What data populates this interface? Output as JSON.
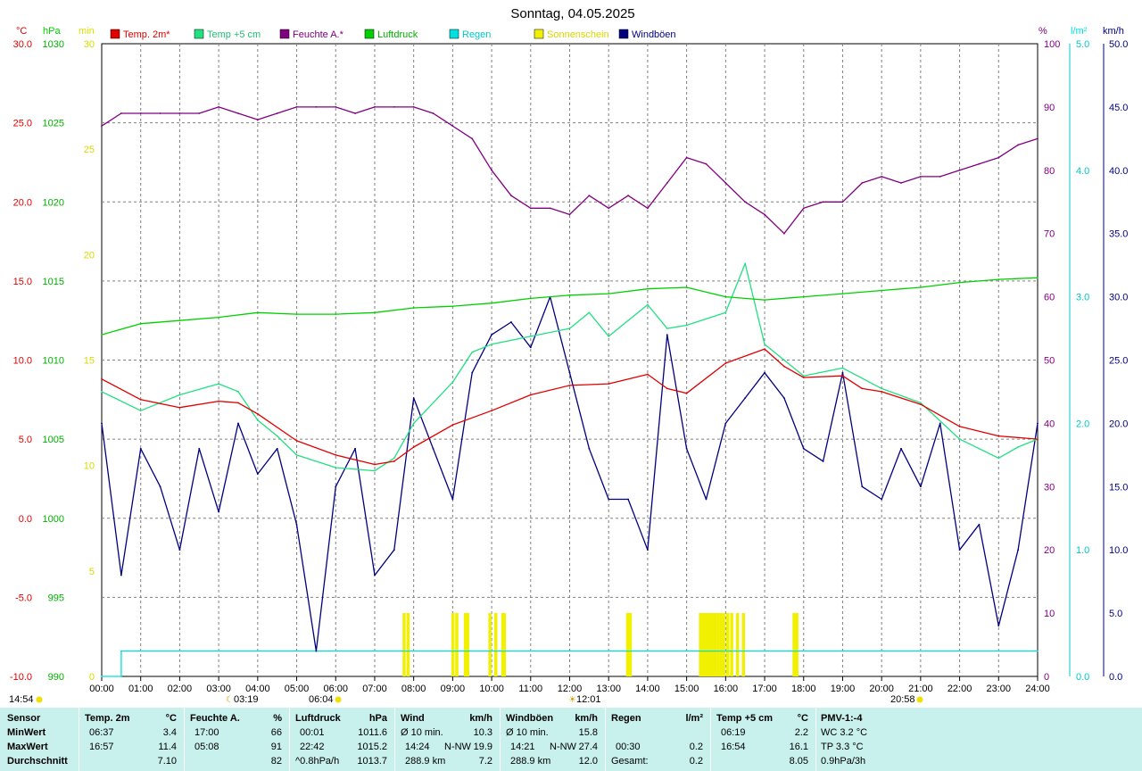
{
  "title": "Sonntag, 04.05.2025",
  "colors": {
    "temp2m": "#e00000",
    "temp5cm": "#20e080",
    "humidity": "#800080",
    "pressure": "#00d000",
    "rain": "#00e0e0",
    "sunshine": "#f0f000",
    "gust": "#00007f",
    "grid": "#808080",
    "stats_bg": "#c8f0ec"
  },
  "chart_data": {
    "type": "line",
    "x_ticks": [
      "00:00",
      "01:00",
      "02:00",
      "03:00",
      "04:00",
      "05:00",
      "06:00",
      "07:00",
      "08:00",
      "09:00",
      "10:00",
      "11:00",
      "12:00",
      "13:00",
      "14:00",
      "15:00",
      "16:00",
      "17:00",
      "18:00",
      "19:00",
      "20:00",
      "21:00",
      "22:00",
      "23:00",
      "24:00"
    ],
    "axes": {
      "temp": {
        "unit": "°C",
        "ticks": [
          "30.0",
          "25.0",
          "20.0",
          "15.0",
          "10.0",
          "5.0",
          "0.0",
          "-5.0",
          "-10.0"
        ],
        "range": [
          -10,
          30
        ]
      },
      "pressure": {
        "unit": "hPa",
        "ticks": [
          "1030",
          "1025",
          "1020",
          "1015",
          "1010",
          "1005",
          "1000",
          "995",
          "990"
        ],
        "range": [
          990,
          1030
        ]
      },
      "sun_min": {
        "unit": "min",
        "ticks": [
          "30",
          "25",
          "20",
          "15",
          "10",
          "5",
          "0"
        ],
        "range": [
          0,
          30
        ]
      },
      "humidity": {
        "unit": "%",
        "ticks": [
          "100",
          "90",
          "80",
          "70",
          "60",
          "50",
          "40",
          "30",
          "20",
          "10",
          "0"
        ],
        "range": [
          0,
          100
        ]
      },
      "rain": {
        "unit": "l/m²",
        "ticks": [
          "5.0",
          "4.0",
          "3.0",
          "2.0",
          "1.0",
          "0.0"
        ],
        "range": [
          0,
          5
        ]
      },
      "wind": {
        "unit": "km/h",
        "ticks": [
          "50.0",
          "45.0",
          "40.0",
          "35.0",
          "30.0",
          "25.0",
          "20.0",
          "15.0",
          "10.0",
          "5.0",
          "0.0"
        ],
        "range": [
          0,
          50
        ]
      }
    },
    "legend": [
      "Temp. 2m*",
      "Temp +5 cm",
      "Feuchte A.*",
      "Luftdruck",
      "Regen",
      "Sonnenschein",
      "Windböen"
    ],
    "markers": {
      "sunrise": "06:04",
      "sunset": "20:58",
      "moonrise": "03:19",
      "solar_noon": "12:01",
      "daylength": "14:54"
    },
    "series": [
      {
        "name": "Temp. 2m*",
        "x": [
          0,
          1,
          2,
          3,
          3.5,
          4,
          5,
          6,
          7,
          7.5,
          8,
          9,
          10,
          11,
          12,
          13,
          14,
          14.5,
          15,
          16,
          17,
          17.5,
          18,
          19,
          19.5,
          20,
          21,
          22,
          23,
          24
        ],
        "values": [
          8.8,
          7.5,
          7.0,
          7.4,
          7.3,
          6.6,
          4.9,
          4.0,
          3.4,
          3.6,
          4.5,
          5.9,
          6.8,
          7.8,
          8.4,
          8.5,
          9.1,
          8.2,
          7.9,
          9.8,
          10.7,
          9.6,
          8.9,
          9.0,
          8.2,
          8.0,
          7.2,
          5.8,
          5.2,
          5.0
        ]
      },
      {
        "name": "Temp +5 cm",
        "x": [
          0,
          1,
          2,
          3,
          3.5,
          4,
          4.5,
          5,
          6,
          7,
          7.5,
          8,
          9,
          9.5,
          10,
          11,
          12,
          12.5,
          13,
          14,
          14.5,
          15,
          16,
          16.5,
          17,
          17.5,
          18,
          19,
          20,
          21,
          22,
          23,
          23.5,
          24
        ],
        "values": [
          8.0,
          6.8,
          7.8,
          8.5,
          8.0,
          6.2,
          5.2,
          4.0,
          3.2,
          3.0,
          3.8,
          6.0,
          8.6,
          10.5,
          11.0,
          11.5,
          12.0,
          13.0,
          11.5,
          13.5,
          12.0,
          12.2,
          13.0,
          16.1,
          11.0,
          10.0,
          9.0,
          9.5,
          8.2,
          7.3,
          5.0,
          3.8,
          4.5,
          5.0
        ]
      },
      {
        "name": "Feuchte A.*",
        "x": [
          0,
          0.5,
          1,
          1.5,
          2,
          2.5,
          3,
          3.5,
          4,
          4.5,
          5,
          5.5,
          6,
          6.5,
          7,
          7.5,
          8,
          8.5,
          9,
          9.5,
          10,
          10.5,
          11,
          11.5,
          12,
          12.5,
          13,
          13.5,
          14,
          14.5,
          15,
          15.5,
          16,
          16.5,
          17,
          17.5,
          18,
          18.5,
          19,
          19.5,
          20,
          20.5,
          21,
          21.5,
          22,
          22.5,
          23,
          23.5,
          24
        ],
        "values": [
          87,
          89,
          89,
          89,
          89,
          89,
          90,
          89,
          88,
          89,
          90,
          90,
          90,
          89,
          90,
          90,
          90,
          89,
          87,
          85,
          80,
          76,
          74,
          74,
          73,
          76,
          74,
          76,
          74,
          78,
          82,
          81,
          78,
          75,
          73,
          70,
          74,
          75,
          75,
          78,
          79,
          78,
          79,
          79,
          80,
          81,
          82,
          84,
          85
        ]
      },
      {
        "name": "Luftdruck",
        "x": [
          0,
          1,
          2,
          3,
          4,
          5,
          6,
          7,
          8,
          9,
          10,
          11,
          12,
          13,
          14,
          15,
          16,
          17,
          18,
          19,
          20,
          21,
          22,
          23,
          24
        ],
        "values": [
          1011.6,
          1012.3,
          1012.5,
          1012.7,
          1013.0,
          1012.9,
          1012.9,
          1013.0,
          1013.3,
          1013.4,
          1013.6,
          1013.9,
          1014.1,
          1014.2,
          1014.5,
          1014.6,
          1014.0,
          1013.8,
          1014.0,
          1014.2,
          1014.4,
          1014.6,
          1014.9,
          1015.1,
          1015.2
        ]
      },
      {
        "name": "Regen",
        "x": [
          0,
          0.5,
          0.5,
          24
        ],
        "values": [
          0,
          0,
          0.2,
          0.2
        ]
      },
      {
        "name": "Windböen",
        "x": [
          0,
          0.5,
          1,
          1.5,
          2,
          2.5,
          3,
          3.5,
          4,
          4.5,
          5,
          5.5,
          6,
          6.5,
          7,
          7.5,
          8,
          8.5,
          9,
          9.5,
          10,
          10.5,
          11,
          11.5,
          12,
          12.5,
          13,
          13.5,
          14,
          14.5,
          15,
          15.5,
          16,
          16.5,
          17,
          17.5,
          18,
          18.5,
          19,
          19.5,
          20,
          20.5,
          21,
          21.5,
          22,
          22.5,
          23,
          23.5,
          24
        ],
        "values": [
          20,
          8,
          18,
          15,
          10,
          18,
          13,
          20,
          16,
          18,
          12,
          2,
          15,
          18,
          8,
          10,
          22,
          18,
          14,
          24,
          27,
          28,
          26,
          30,
          24,
          18,
          14,
          14,
          10,
          27,
          18,
          14,
          20,
          22,
          24,
          22,
          18,
          17,
          24,
          15,
          14,
          18,
          15,
          20,
          10,
          12,
          4,
          10,
          20
        ]
      }
    ],
    "sunshine_bars_hours": [
      7.75,
      7.85,
      9.0,
      9.1,
      9.32,
      9.38,
      9.95,
      10.1,
      10.28,
      10.32,
      13.48,
      13.55,
      15.35,
      15.42,
      15.5,
      15.58,
      15.65,
      15.72,
      15.8,
      15.88,
      15.95,
      16.05,
      16.15,
      16.3,
      16.45,
      17.75,
      17.82
    ]
  },
  "stats": {
    "sensor": {
      "header": "Sensor",
      "rows": [
        "MinWert",
        "MaxWert",
        "Durchschnitt"
      ]
    },
    "temp2m": {
      "header": "Temp. 2m",
      "unit": "°C",
      "min_time": "06:37",
      "min": "3.4",
      "max_time": "16:57",
      "max": "11.4",
      "avg": "7.10"
    },
    "humidity": {
      "header": "Feuchte A.",
      "unit": "%",
      "min_time": "17:00",
      "min": "66",
      "max_time": "05:08",
      "max": "91",
      "avg": "82"
    },
    "pressure": {
      "header": "Luftdruck",
      "unit": "hPa",
      "min_time": "00:01",
      "min": "1011.6",
      "max_time": "22:42",
      "max": "1015.2",
      "trend": "^0.8hPa/h",
      "avg": "1013.7"
    },
    "wind": {
      "header": "Wind",
      "unit": "km/h",
      "r1_label": "Ø 10 min.",
      "r1_val": "10.3",
      "r2_time": "14:24",
      "r2_dir": "N-NW",
      "r2_val": "19.9",
      "r3_dist": "288.9 km",
      "r3_val": "7.2"
    },
    "gust": {
      "header": "Windböen",
      "unit": "km/h",
      "r1_label": "Ø 10 min.",
      "r1_val": "15.8",
      "r2_time": "14:21",
      "r2_dir": "N-NW",
      "r2_val": "27.4",
      "r3_dist": "288.9 km",
      "r3_val": "12.0"
    },
    "rain": {
      "header": "Regen",
      "unit": "l/m²",
      "r2_time": "00:30",
      "r2_val": "0.2",
      "r3_label": "Gesamt:",
      "r3_val": "0.2"
    },
    "temp5": {
      "header": "Temp +5 cm",
      "unit": "°C",
      "min_time": "06:19",
      "min": "2.2",
      "max_time": "16:54",
      "max": "16.1",
      "avg": "8.05"
    },
    "pmv": {
      "header": "PMV-1:-4",
      "r1": "WC 3.2 °C",
      "r2": "TP 3.3 °C",
      "r3": "0.9hPa/3h"
    }
  }
}
